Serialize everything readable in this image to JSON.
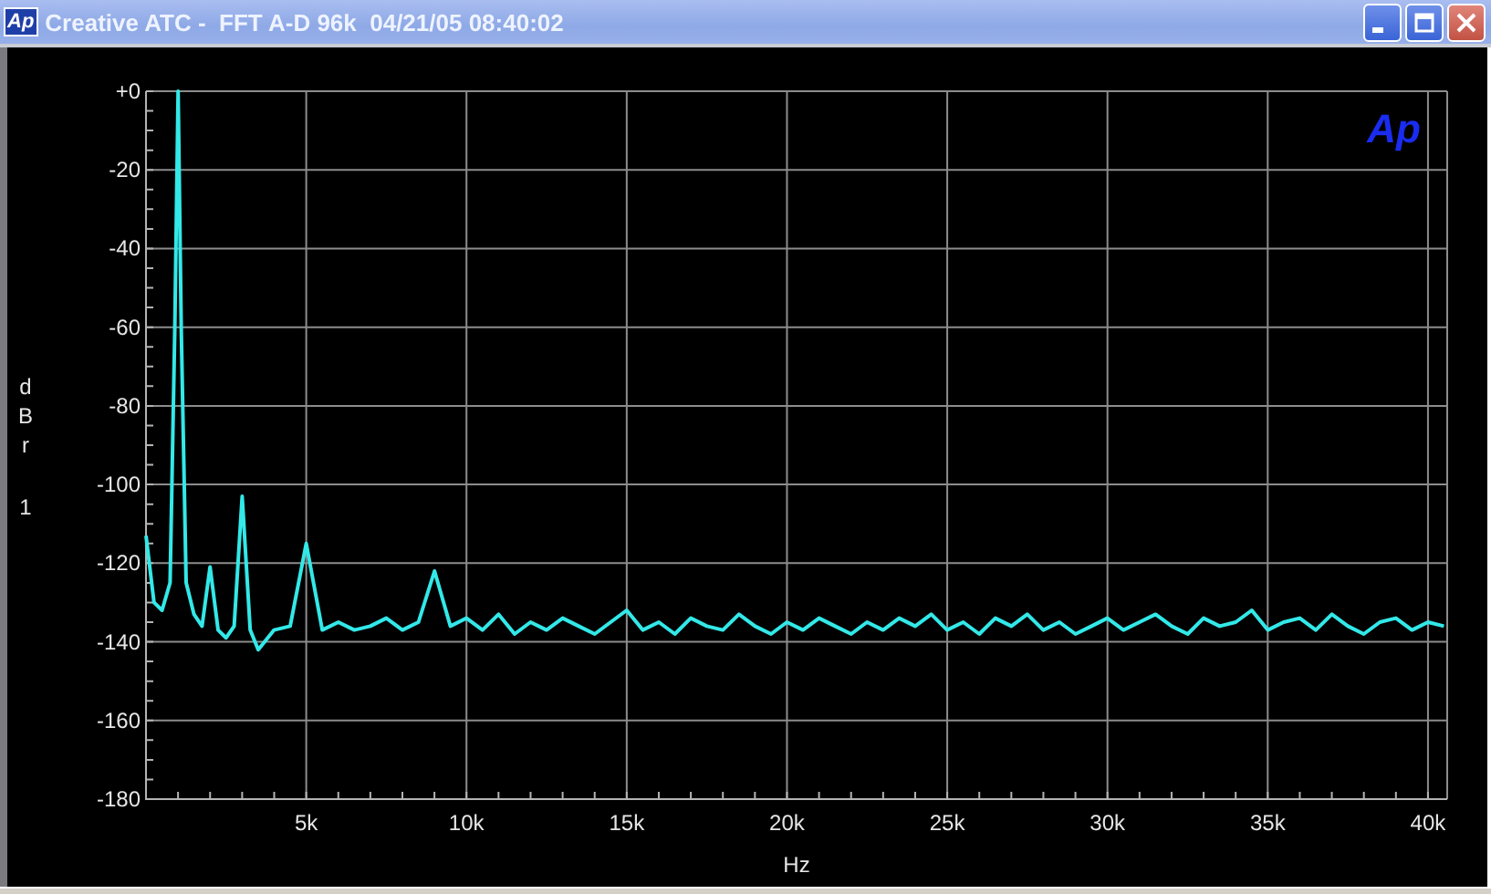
{
  "window": {
    "icon_text": "Ap",
    "title": "Creative ATC -  FFT A-D 96k  04/21/05 08:40:02",
    "buttons": [
      {
        "kind": "minimize"
      },
      {
        "kind": "maximize"
      },
      {
        "kind": "close"
      }
    ]
  },
  "graph": {
    "logo": "Ap",
    "channel_label": "1",
    "chart_data": {
      "type": "line",
      "grid": true,
      "xlabel": "Hz",
      "ylabel": "dBr",
      "xlim": [
        0,
        40600
      ],
      "ylim": [
        -180,
        0
      ],
      "xticks": [
        {
          "value": 5000,
          "label": "5k"
        },
        {
          "value": 10000,
          "label": "10k"
        },
        {
          "value": 15000,
          "label": "15k"
        },
        {
          "value": 20000,
          "label": "20k"
        },
        {
          "value": 25000,
          "label": "25k"
        },
        {
          "value": 30000,
          "label": "30k"
        },
        {
          "value": 35000,
          "label": "35k"
        },
        {
          "value": 40000,
          "label": "40k"
        }
      ],
      "yticks": [
        {
          "value": 0,
          "label": "+0"
        },
        {
          "value": -20,
          "label": "-20"
        },
        {
          "value": -40,
          "label": "-40"
        },
        {
          "value": -60,
          "label": "-60"
        },
        {
          "value": -80,
          "label": "-80"
        },
        {
          "value": -100,
          "label": "-100"
        },
        {
          "value": -120,
          "label": "-120"
        },
        {
          "value": -140,
          "label": "-140"
        },
        {
          "value": -160,
          "label": "-160"
        },
        {
          "value": -180,
          "label": "-180"
        }
      ],
      "x": [
        0,
        250,
        500,
        750,
        900,
        1000,
        1100,
        1250,
        1500,
        1750,
        2000,
        2250,
        2500,
        2750,
        3000,
        3250,
        3500,
        4000,
        4500,
        5000,
        5500,
        6000,
        6500,
        7000,
        7500,
        8000,
        8500,
        9000,
        9500,
        10000,
        10500,
        11000,
        11500,
        12000,
        12500,
        13000,
        13500,
        14000,
        14500,
        15000,
        15500,
        16000,
        16500,
        17000,
        17500,
        18000,
        18500,
        19000,
        19500,
        20000,
        20500,
        21000,
        21500,
        22000,
        22500,
        23000,
        23500,
        24000,
        24500,
        25000,
        25500,
        26000,
        26500,
        27000,
        27500,
        28000,
        28500,
        29000,
        29500,
        30000,
        30500,
        31000,
        31500,
        32000,
        32500,
        33000,
        33500,
        34000,
        34500,
        35000,
        35500,
        36000,
        36500,
        37000,
        37500,
        38000,
        38500,
        39000,
        39500,
        40000,
        40500
      ],
      "series": [
        {
          "color": "#33e8e8",
          "values": [
            -113,
            -130,
            -132,
            -125,
            -60,
            0,
            -60,
            -125,
            -133,
            -136,
            -121,
            -137,
            -139,
            -136,
            -103,
            -137,
            -142,
            -137,
            -136,
            -115,
            -137,
            -135,
            -137,
            -136,
            -134,
            -137,
            -135,
            -122,
            -136,
            -134,
            -137,
            -133,
            -138,
            -135,
            -137,
            -134,
            -136,
            -138,
            -135,
            -132,
            -137,
            -135,
            -138,
            -134,
            -136,
            -137,
            -133,
            -136,
            -138,
            -135,
            -137,
            -134,
            -136,
            -138,
            -135,
            -137,
            -134,
            -136,
            -133,
            -137,
            -135,
            -138,
            -134,
            -136,
            -133,
            -137,
            -135,
            -138,
            -136,
            -134,
            -137,
            -135,
            -133,
            -136,
            -138,
            -134,
            -136,
            -135,
            -132,
            -137,
            -135,
            -134,
            -137,
            -133,
            -136,
            -138,
            -135,
            -134,
            -137,
            -135,
            -136
          ]
        }
      ]
    }
  }
}
